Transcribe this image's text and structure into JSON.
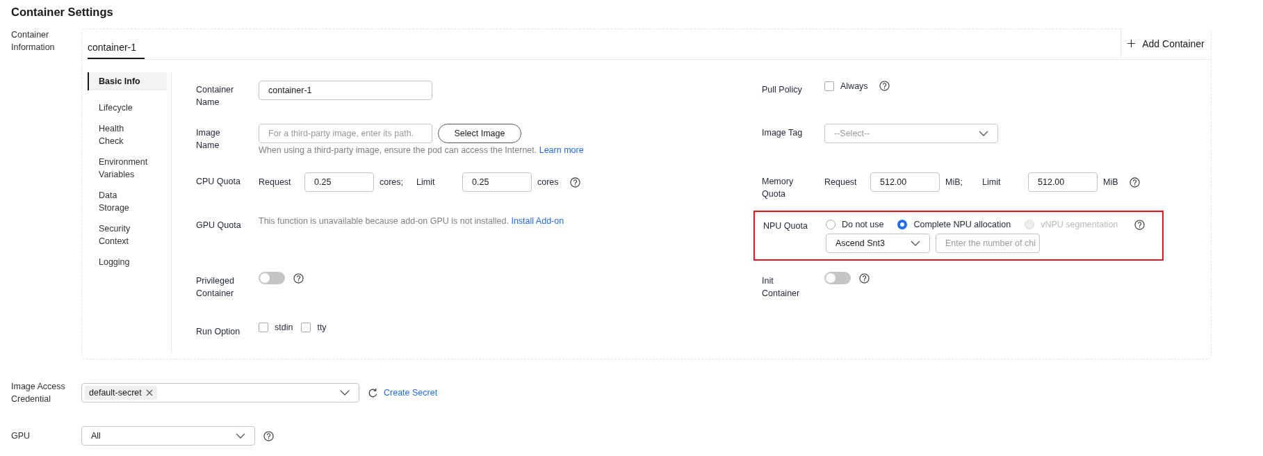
{
  "title": "Container Settings",
  "container_info": {
    "label": "Container Information",
    "tabs": [
      {
        "label": "container-1",
        "selected": true
      }
    ],
    "add_button": "Add Container",
    "nav": [
      {
        "label": "Basic Info",
        "selected": true
      },
      {
        "label": "Lifecycle",
        "selected": false
      },
      {
        "label": "Health Check",
        "selected": false
      },
      {
        "label": "Environment Variables",
        "selected": false
      },
      {
        "label": "Data Storage",
        "selected": false
      },
      {
        "label": "Security Context",
        "selected": false
      },
      {
        "label": "Logging",
        "selected": false
      }
    ],
    "left_fields": [
      {
        "kind": "text",
        "label": "Container Name",
        "value": "container-1"
      },
      {
        "kind": "image",
        "label": "Image Name",
        "placeholder": "For a third-party image, enter its path.",
        "button": "Select Image",
        "hint": "When using a third-party image, ensure the pod can access the Internet.",
        "link": "Learn more"
      },
      {
        "kind": "quota",
        "label": "CPU Quota",
        "request_label": "Request",
        "request": "0.25",
        "request_unit": "cores;",
        "limit_label": "Limit",
        "limit": "0.25",
        "limit_unit": "cores",
        "help": true
      },
      {
        "kind": "notice",
        "label": "GPU Quota",
        "text": "This function is unavailable because add-on GPU is not installed.",
        "link": "Install Add-on"
      },
      {
        "kind": "switch",
        "label": "Privileged Container",
        "on": false,
        "help": true
      },
      {
        "kind": "checkboxes",
        "label": "Run Option",
        "options": [
          {
            "label": "stdin",
            "checked": false
          },
          {
            "label": "tty",
            "checked": false
          }
        ]
      }
    ],
    "right_fields": [
      {
        "kind": "checkboxes",
        "label": "Pull Policy",
        "options": [
          {
            "label": "Always",
            "checked": false
          }
        ],
        "help": true
      },
      {
        "kind": "select",
        "label": "Image Tag",
        "placeholder": "--Select--"
      },
      {
        "kind": "quota",
        "label": "Memory Quota",
        "request_label": "Request",
        "request": "512.00",
        "request_unit": "MiB;",
        "limit_label": "Limit",
        "limit": "512.00",
        "limit_unit": "MiB",
        "help": true
      },
      {
        "kind": "radio",
        "label": "NPU Quota",
        "highlighted": true,
        "help": true,
        "options": [
          {
            "label": "Do not use",
            "selected": false,
            "disabled": false
          },
          {
            "label": "Complete NPU allocation",
            "selected": true,
            "disabled": false
          },
          {
            "label": "vNPU segmentation",
            "selected": false,
            "disabled": true
          }
        ],
        "model": "Ascend Snt3",
        "count_placeholder": "Enter the number of chi"
      },
      {
        "kind": "switch",
        "label": "Init Container",
        "on": false,
        "help": true
      }
    ]
  },
  "image_access_credential": {
    "label": "Image Access Credential",
    "tags": [
      "default-secret"
    ],
    "link": "Create Secret"
  },
  "gpu": {
    "label": "GPU",
    "value": "All",
    "help": true
  }
}
